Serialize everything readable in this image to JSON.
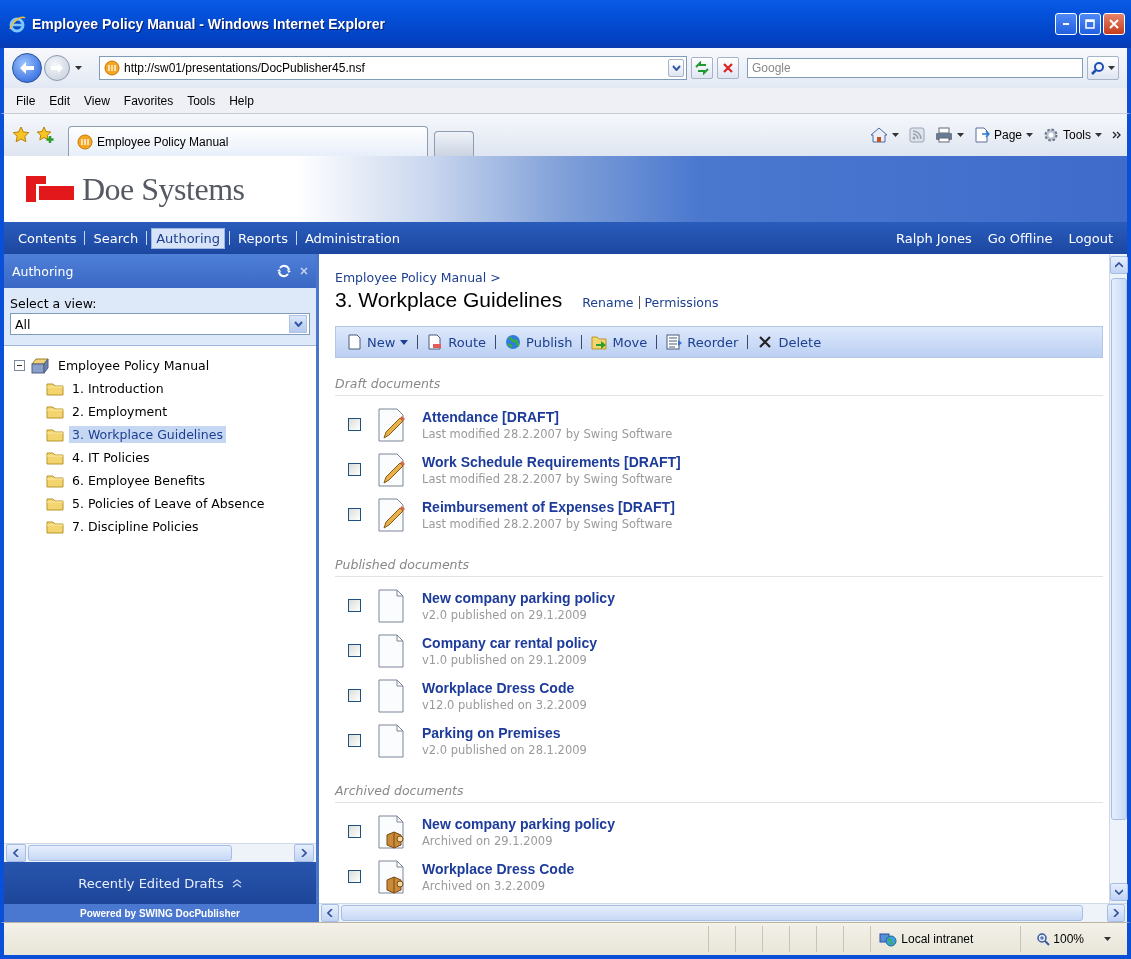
{
  "window": {
    "title": "Employee Policy Manual - Windows Internet Explorer"
  },
  "address_bar": {
    "url": "http://sw01/presentations/DocPublisher45.nsf",
    "search_placeholder": "Google"
  },
  "menu": [
    "File",
    "Edit",
    "View",
    "Favorites",
    "Tools",
    "Help"
  ],
  "browser_tabs": [
    {
      "label": "Employee Policy Manual",
      "selected": true
    }
  ],
  "command_bar": [
    "Page",
    "Tools"
  ],
  "site": {
    "logo": "Doe Systems"
  },
  "nav": [
    {
      "label": "Contents",
      "selected": false
    },
    {
      "label": "Search",
      "selected": false
    },
    {
      "label": "Authoring",
      "selected": true
    },
    {
      "label": "Reports",
      "selected": false
    },
    {
      "label": "Administration",
      "selected": false
    }
  ],
  "user_links": [
    "Ralph Jones",
    "Go Offline",
    "Logout"
  ],
  "sidebar": {
    "title": "Authoring",
    "view_label": "Select a view:",
    "view_value": "All",
    "tree": {
      "label": "Employee Policy Manual",
      "expanded": true,
      "children": [
        {
          "label": "1. Introduction",
          "selected": false
        },
        {
          "label": "2. Employment",
          "selected": false
        },
        {
          "label": "3. Workplace Guidelines",
          "selected": true
        },
        {
          "label": "4. IT Policies",
          "selected": false
        },
        {
          "label": "6. Employee Benefits",
          "selected": false
        },
        {
          "label": "5. Policies of Leave of Absence",
          "selected": false
        },
        {
          "label": "7. Discipline Policies",
          "selected": false
        }
      ]
    },
    "footer": "Recently Edited Drafts",
    "powered_by": "Powered by SWING DocPublisher"
  },
  "main": {
    "breadcrumb": "Employee Policy Manual >",
    "title": "3. Workplace Guidelines",
    "actions": [
      "Rename",
      "Permissions"
    ],
    "toolbar": [
      {
        "label": "New",
        "kind": "new"
      },
      {
        "label": "Route",
        "kind": "route"
      },
      {
        "label": "Publish",
        "kind": "publish"
      },
      {
        "label": "Move",
        "kind": "move"
      },
      {
        "label": "Reorder",
        "kind": "reorder"
      },
      {
        "label": "Delete",
        "kind": "delete"
      }
    ],
    "sections": [
      {
        "title": "Draft documents",
        "kind": "draft",
        "documents": [
          {
            "title": "Attendance [DRAFT]",
            "info": "Last modified 28.2.2007 by Swing Software",
            "checked": false
          },
          {
            "title": "Work Schedule Requirements [DRAFT]",
            "info": "Last modified 28.2.2007 by Swing Software",
            "checked": false
          },
          {
            "title": "Reimbursement of Expenses [DRAFT]",
            "info": "Last modified 28.2.2007 by Swing Software",
            "checked": false
          }
        ]
      },
      {
        "title": "Published documents",
        "kind": "published",
        "documents": [
          {
            "title": "New company parking policy",
            "info": "v2.0 published on 29.1.2009",
            "checked": false
          },
          {
            "title": "Company car rental policy",
            "info": "v1.0 published on 29.1.2009",
            "checked": false
          },
          {
            "title": "Workplace Dress Code",
            "info": "v12.0 published on 3.2.2009",
            "checked": false
          },
          {
            "title": "Parking on Premises",
            "info": "v2.0 published on 28.1.2009",
            "checked": false
          }
        ]
      },
      {
        "title": "Archived documents",
        "kind": "archived",
        "documents": [
          {
            "title": "New company parking policy",
            "info": "Archived on 29.1.2009",
            "checked": false
          },
          {
            "title": "Workplace Dress Code",
            "info": "Archived on 3.2.2009",
            "checked": false
          }
        ]
      }
    ]
  },
  "status_bar": {
    "zone": "Local intranet",
    "zoom": "100%"
  }
}
